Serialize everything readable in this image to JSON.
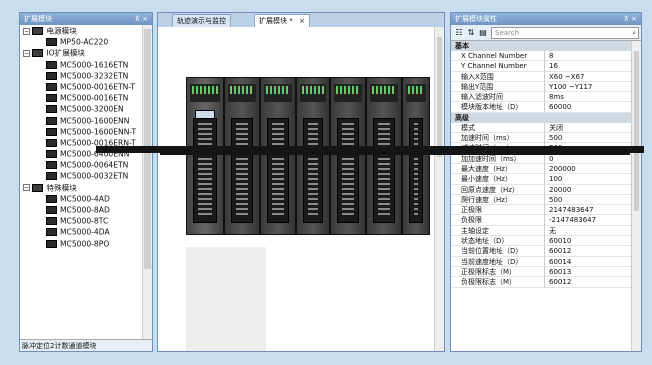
{
  "left": {
    "title": "扩展模块",
    "pin": "⊼ ×",
    "tree": [
      {
        "label": "电源模块",
        "level": 0,
        "expander": "−"
      },
      {
        "label": "MP50-AC220",
        "level": 1
      },
      {
        "label": "IO扩展模块",
        "level": 0,
        "expander": "−"
      },
      {
        "label": "MC5000-1616ETN",
        "level": 1
      },
      {
        "label": "MC5000-3232ETN",
        "level": 1
      },
      {
        "label": "MC5000-0016ETN-T",
        "level": 1
      },
      {
        "label": "MC5000-0016ETN",
        "level": 1
      },
      {
        "label": "MC5000-3200EN",
        "level": 1
      },
      {
        "label": "MC5000-1600ENN",
        "level": 1
      },
      {
        "label": "MC5000-1600ENN-T",
        "level": 1
      },
      {
        "label": "MC5000-0016ERN-T",
        "level": 1
      },
      {
        "label": "MC5000-6400ENN",
        "level": 1
      },
      {
        "label": "MC5000-0064ETN",
        "level": 1
      },
      {
        "label": "MC5000-0032ETN",
        "level": 1
      },
      {
        "label": "特殊模块",
        "level": 0,
        "expander": "−"
      },
      {
        "label": "MC5000-4AD",
        "level": 1
      },
      {
        "label": "MC5000-8AD",
        "level": 1
      },
      {
        "label": "MC5000-8TC",
        "level": 1
      },
      {
        "label": "MC5000-4DA",
        "level": 1
      },
      {
        "label": "MC5000-8PO",
        "level": 1
      }
    ],
    "status": "脉冲定位2计数通道模块"
  },
  "center": {
    "tabs": [
      {
        "label": "轨迹演示与监控",
        "active": false
      },
      {
        "label": "扩展模块 *",
        "active": true
      }
    ],
    "tab_close": "×"
  },
  "right": {
    "title": "扩展模块属性",
    "pin": "⊼ ×",
    "search_placeholder": "Search",
    "search_icon": "⌕",
    "categories": [
      {
        "name": "基本",
        "rows": [
          {
            "k": "X Channel Number",
            "v": "8"
          },
          {
            "k": "Y Channel Number",
            "v": "16"
          },
          {
            "k": "输入X范围",
            "v": "X60 ~X67"
          },
          {
            "k": "输出Y范围",
            "v": "Y100 ~Y117"
          },
          {
            "k": "输入滤波时间",
            "v": "8ms"
          },
          {
            "k": "模块版本地址（D）",
            "v": "60000"
          }
        ]
      },
      {
        "name": "高级",
        "rows": [
          {
            "k": "模式",
            "v": "关闭"
          },
          {
            "k": "加速时间（ms）",
            "v": "500"
          },
          {
            "k": "减速时间（ms）",
            "v": "500"
          },
          {
            "k": "加加速时间（ms）",
            "v": "0"
          },
          {
            "k": "最大速度（Hz）",
            "v": "200000"
          },
          {
            "k": "最小速度（Hz）",
            "v": "100"
          },
          {
            "k": "回原点速度（Hz）",
            "v": "20000"
          },
          {
            "k": "爬行速度（Hz）",
            "v": "500"
          },
          {
            "k": "正极限",
            "v": "2147483647"
          },
          {
            "k": "负极限",
            "v": "-2147483647"
          },
          {
            "k": "主轴设定",
            "v": "无"
          },
          {
            "k": "状态地址（D）",
            "v": "60010"
          },
          {
            "k": "当前位置地址（D）",
            "v": "60012"
          },
          {
            "k": "当前速度地址（D）",
            "v": "60014"
          },
          {
            "k": "正极限标志（M）",
            "v": "60013"
          },
          {
            "k": "负极限标志（M）",
            "v": "60012"
          }
        ]
      }
    ]
  }
}
